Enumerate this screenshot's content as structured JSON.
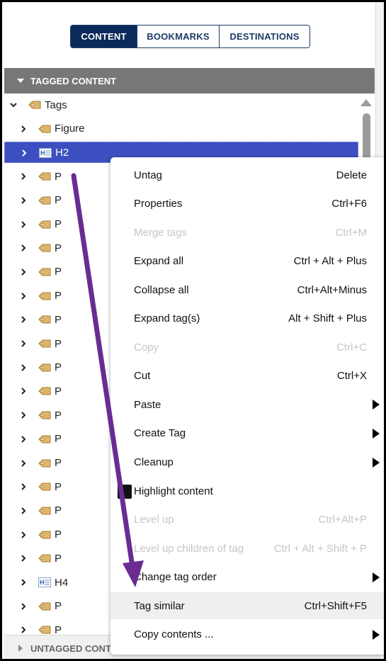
{
  "tabs": [
    {
      "label": "CONTENT",
      "active": true
    },
    {
      "label": "BOOKMARKS",
      "active": false
    },
    {
      "label": "DESTINATIONS",
      "active": false
    }
  ],
  "section_header": "TAGGED CONTENT",
  "tree": {
    "root": {
      "label": "Tags",
      "icon": "tag-icon"
    },
    "rows": [
      {
        "label": "Figure",
        "icon": "tag-icon"
      },
      {
        "label": "H2",
        "icon": "heading-icon",
        "selected": true
      },
      {
        "label": "P",
        "icon": "tag-icon"
      },
      {
        "label": "P",
        "icon": "tag-icon"
      },
      {
        "label": "P",
        "icon": "tag-icon"
      },
      {
        "label": "P",
        "icon": "tag-icon"
      },
      {
        "label": "P",
        "icon": "tag-icon"
      },
      {
        "label": "P",
        "icon": "tag-icon"
      },
      {
        "label": "P",
        "icon": "tag-icon"
      },
      {
        "label": "P",
        "icon": "tag-icon"
      },
      {
        "label": "P",
        "icon": "tag-icon"
      },
      {
        "label": "P",
        "icon": "tag-icon"
      },
      {
        "label": "P",
        "icon": "tag-icon"
      },
      {
        "label": "P",
        "icon": "tag-icon"
      },
      {
        "label": "P",
        "icon": "tag-icon"
      },
      {
        "label": "P",
        "icon": "tag-icon"
      },
      {
        "label": "P",
        "icon": "tag-icon"
      },
      {
        "label": "P",
        "icon": "tag-icon"
      },
      {
        "label": "P",
        "icon": "tag-icon"
      },
      {
        "label": "H4",
        "icon": "heading-icon"
      },
      {
        "label": "P",
        "icon": "tag-icon"
      },
      {
        "label": "P",
        "icon": "tag-icon"
      }
    ]
  },
  "footer_header": "UNTAGGED CONTENT",
  "context_menu": [
    {
      "label": "Untag",
      "shortcut": "Delete"
    },
    {
      "label": "Properties",
      "shortcut": "Ctrl+F6"
    },
    {
      "label": "Merge tags",
      "shortcut": "Ctrl+M",
      "disabled": true
    },
    {
      "label": "Expand all",
      "shortcut": "Ctrl + Alt + Plus"
    },
    {
      "label": "Collapse all",
      "shortcut": "Ctrl+Alt+Minus"
    },
    {
      "label": "Expand tag(s)",
      "shortcut": "Alt + Shift + Plus"
    },
    {
      "label": "Copy",
      "shortcut": "Ctrl+C",
      "disabled": true
    },
    {
      "label": "Cut",
      "shortcut": "Ctrl+X"
    },
    {
      "label": "Paste",
      "shortcut": "",
      "submenu": true
    },
    {
      "label": "Create Tag",
      "shortcut": "",
      "submenu": true
    },
    {
      "label": "Cleanup",
      "shortcut": "",
      "submenu": true
    },
    {
      "label": "Highlight content",
      "shortcut": "",
      "checked": true
    },
    {
      "label": "Level up",
      "shortcut": "Ctrl+Alt+P",
      "disabled": true
    },
    {
      "label": "Level up children of tag",
      "shortcut": "Ctrl + Alt + Shift + P",
      "disabled": true
    },
    {
      "label": "Change tag order",
      "shortcut": "",
      "submenu": true
    },
    {
      "label": "Tag similar",
      "shortcut": "Ctrl+Shift+F5",
      "hover": true
    },
    {
      "label": "Copy contents ...",
      "shortcut": "",
      "submenu": true
    }
  ],
  "colors": {
    "tab_active_bg": "#0a2a5c",
    "selected_row_bg": "#3d4fc0",
    "annotation_arrow": "#6a2c91",
    "section_header_bg": "#777777"
  }
}
